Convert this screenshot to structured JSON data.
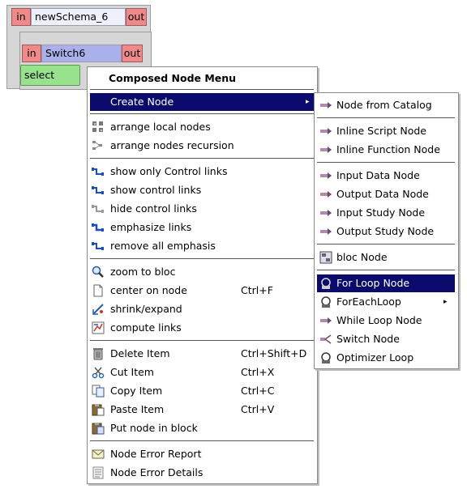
{
  "schema": {
    "in_label": "in",
    "title": "newSchema_6",
    "out_label": "out",
    "switch_in": "in",
    "switch_name": "Switch6",
    "switch_out": "out",
    "select_label": "select"
  },
  "main_menu": {
    "title": "Composed Node Menu",
    "create_node": "Create Node",
    "arrange_local": "arrange local nodes",
    "arrange_recursion": "arrange nodes recursion",
    "show_only_control": "show only Control links",
    "show_control": "show control links",
    "hide_control": "hide control links",
    "emphasize": "emphasize links",
    "remove_emphasis": "remove all emphasis",
    "zoom_bloc": "zoom to bloc",
    "center_node": "center on node",
    "center_node_sc": "Ctrl+F",
    "shrink_expand": "shrink/expand",
    "compute_links": "compute links",
    "delete_item": "Delete Item",
    "delete_item_sc": "Ctrl+Shift+D",
    "cut_item": "Cut Item",
    "cut_item_sc": "Ctrl+X",
    "copy_item": "Copy Item",
    "copy_item_sc": "Ctrl+C",
    "paste_item": "Paste Item",
    "paste_item_sc": "Ctrl+V",
    "put_in_block": "Put node in block",
    "error_report": "Node Error Report",
    "error_details": "Node Error Details"
  },
  "sub_menu": {
    "from_catalog": "Node from Catalog",
    "inline_script": "Inline Script Node",
    "inline_function": "Inline Function Node",
    "input_data": "Input Data Node",
    "output_data": "Output Data Node",
    "input_study": "Input Study Node",
    "output_study": "Output Study Node",
    "bloc": "bloc Node",
    "for_loop": "For Loop Node",
    "foreach": "ForEachLoop",
    "while_loop": "While Loop Node",
    "switch": "Switch Node",
    "optimizer": "Optimizer Loop"
  },
  "colors": {
    "highlight": "#0b0b6e",
    "port": "#f08a8a",
    "select_box": "#98e28e"
  }
}
